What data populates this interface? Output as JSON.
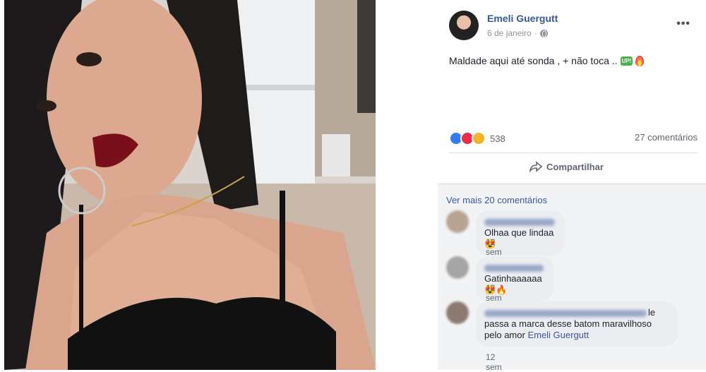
{
  "post": {
    "author": "Emeli Guergutt",
    "date": "6 de janeiro",
    "text": "Maldade aqui até sonda , + não toca ..",
    "emoji_up": "UP!",
    "reactions_count": "538",
    "comments_count": "27 comentários",
    "share_label": "Compartilhar",
    "more_label": "•••"
  },
  "comments": {
    "see_more": "Ver mais 20 comentários",
    "items": [
      {
        "text": "Olhaa que lindaa 😍",
        "time": "12 sem"
      },
      {
        "text": "Gatinhaaaaaa 😍🔥",
        "time": "12 sem"
      },
      {
        "text_lines": [
          "le",
          "passa a marca desse batom maravilhoso",
          "pelo amor"
        ],
        "mention": "Emeli Guergutt",
        "time": "12 sem"
      }
    ]
  },
  "colors": {
    "link": "#385898",
    "like": "#2e7cf6",
    "love": "#f0284a",
    "wow": "#f7b125"
  },
  "icons": [
    "globe-icon",
    "share-icon",
    "like-reaction-icon",
    "love-reaction-icon",
    "wow-reaction-icon",
    "more-options-icon"
  ]
}
